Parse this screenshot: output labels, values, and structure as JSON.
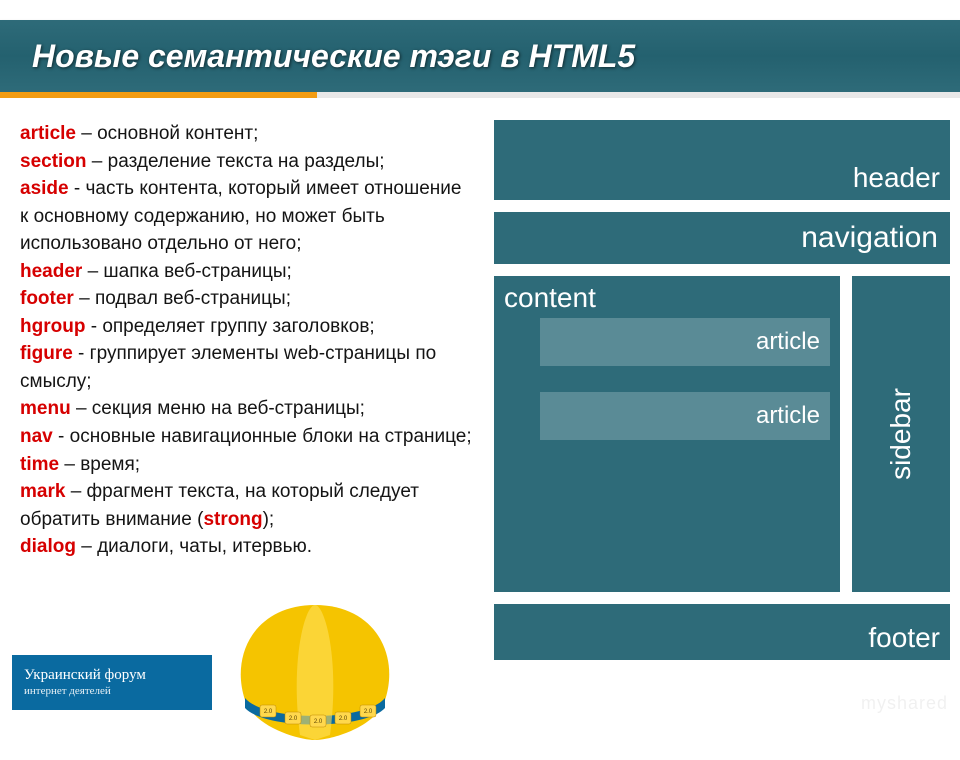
{
  "slide": {
    "title": "Новые семантические тэги в HTML5"
  },
  "terms": [
    {
      "name": "article",
      "desc": " – основной контент;"
    },
    {
      "name": "section",
      "desc": " – разделение текста на разделы;"
    },
    {
      "name": "aside",
      "desc": " - часть контента, который имеет отношение к основному содержанию, но может быть использовано отдельно от него;"
    },
    {
      "name": "header",
      "desc": " – шапка веб-страницы;"
    },
    {
      "name": "footer",
      "desc": " – подвал веб-страницы;"
    },
    {
      "name": "hgroup",
      "desc": " - определяет группу заголовков;"
    },
    {
      "name": "figure",
      "desc": " - группирует элементы web-страницы по смыслу;"
    },
    {
      "name": "menu",
      "desc": " – секция меню на веб-страницы;"
    },
    {
      "name": "nav",
      "desc": " - основные навигационные блоки на странице;"
    },
    {
      "name": "time",
      "desc": " – время;"
    },
    {
      "name": "mark",
      "desc_pre": " – фрагмент текста, на который следует обратить внимание (",
      "hl": "strong",
      "desc_post": ");"
    },
    {
      "name": "dialog",
      "desc": " – диалоги, чаты, итервью."
    }
  ],
  "diagram": {
    "header": "header",
    "navigation": "navigation",
    "content": "content",
    "article1": "article",
    "article2": "article",
    "sidebar": "sidebar",
    "footer": "footer"
  },
  "badge": {
    "line1": "Украинский форум",
    "line2": "интернет деятелей"
  },
  "watermark": "myshared"
}
